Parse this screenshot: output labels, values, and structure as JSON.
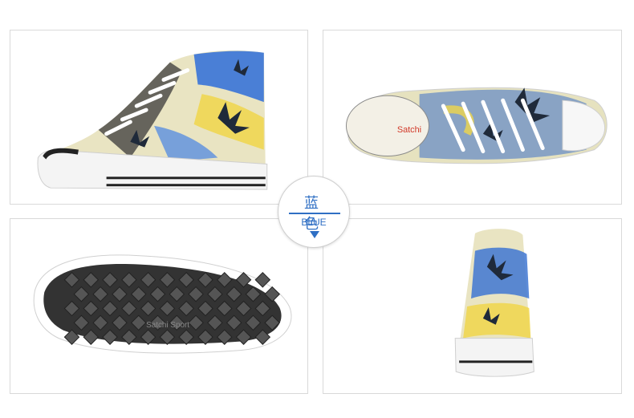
{
  "color_badge": {
    "chinese_label": "蓝 色",
    "english_label": "BLUE",
    "accent_color": "#2f6fc4",
    "arrow_icon": "down-triangle-icon"
  },
  "photos": [
    {
      "view": "side"
    },
    {
      "view": "top"
    },
    {
      "view": "sole",
      "sole_text": "Satchi Sport"
    },
    {
      "view": "back"
    }
  ],
  "insole_text": "Satchi"
}
